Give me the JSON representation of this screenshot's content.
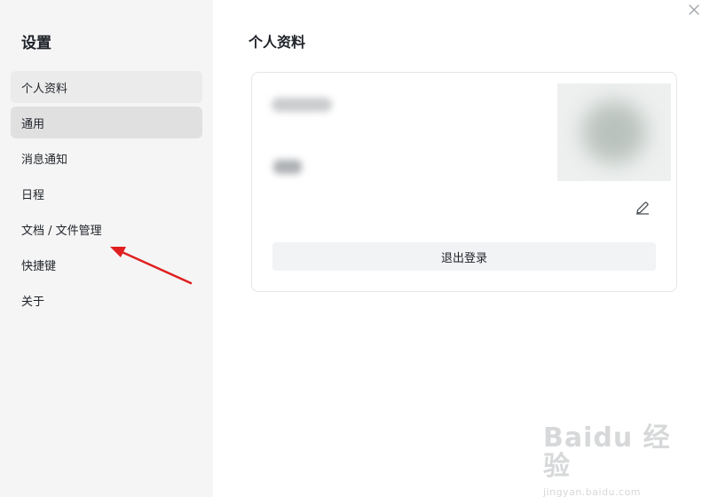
{
  "sidebar": {
    "title": "设置",
    "items": [
      {
        "label": "个人资料"
      },
      {
        "label": "通用"
      },
      {
        "label": "消息通知"
      },
      {
        "label": "日程"
      },
      {
        "label": "文档 / 文件管理"
      },
      {
        "label": "快捷键"
      },
      {
        "label": "关于"
      }
    ]
  },
  "main": {
    "title": "个人资料",
    "logout_label": "退出登录"
  },
  "icons": {
    "close": "close-icon",
    "edit": "pencil-icon"
  },
  "colors": {
    "sidebar_bg": "#f5f5f5",
    "active_item_bg": "#e0e0e1",
    "annotation_arrow": "#e02020"
  },
  "watermark": {
    "brand": "Baidu 经验",
    "sub": "jingyan.baidu.com"
  }
}
